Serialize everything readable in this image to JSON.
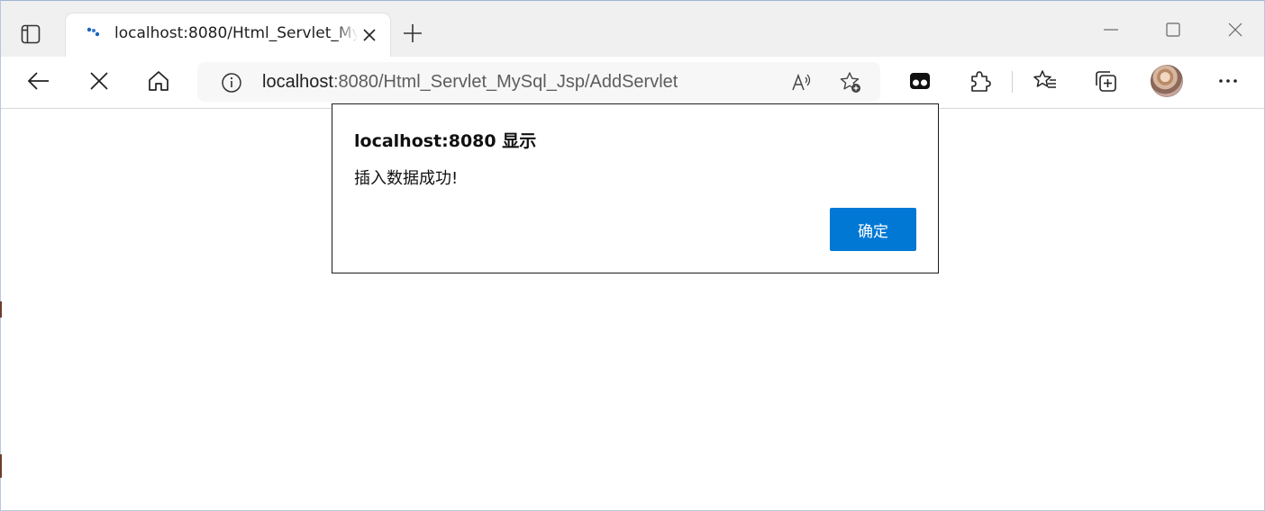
{
  "browser": {
    "tab": {
      "title": "localhost:8080/Html_Servlet_MySql_Jsp/AddServlet",
      "favicon": "loading-dots-icon"
    },
    "address_bar": {
      "host": "localhost",
      "path": ":8080/Html_Servlet_MySql_Jsp/AddServlet"
    },
    "icons": {
      "tab_actions": "tab-actions-icon",
      "new_tab": "plus-icon",
      "minimize": "minimize-icon",
      "maximize": "maximize-icon",
      "close": "close-icon",
      "back": "back-arrow-icon",
      "stop": "stop-icon",
      "home": "home-icon",
      "info": "info-icon",
      "read_aloud": "read-aloud-icon",
      "add_favorite": "add-favorite-icon",
      "extension_app": "extension-app-icon",
      "extensions": "puzzle-icon",
      "favorites": "favorites-icon",
      "collections": "collections-icon",
      "profile": "avatar",
      "more": "more-icon"
    },
    "accent_color": "#0078d4"
  },
  "dialog": {
    "title": "localhost:8080 显示",
    "message": "插入数据成功!",
    "ok_label": "确定"
  }
}
